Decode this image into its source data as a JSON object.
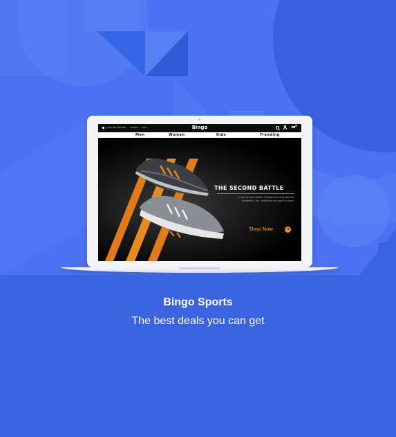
{
  "colors": {
    "page_background": "#3a63e0",
    "hero_background": "#4a72f2",
    "accent_orange": "#f08a1c"
  },
  "website": {
    "topbar": {
      "phone": "(+34) 567 890 456",
      "language": "English ⌄",
      "currency": "USD ⌄",
      "brand": "Bingo",
      "icons": [
        "search-icon",
        "user-icon",
        "cart-icon"
      ]
    },
    "nav": [
      "Men",
      "Women",
      "Kids",
      "Trending"
    ],
    "banner": {
      "title": "THE SECOND BATTLE",
      "description": "In the second battle. Sivegaud and prefaphas ulsugafitu, etc. anything you want to type.",
      "cta": "Shop Now",
      "cta_icon": "→"
    }
  },
  "caption": {
    "title": "Bingo Sports",
    "subtitle": "The best deals you can get"
  }
}
